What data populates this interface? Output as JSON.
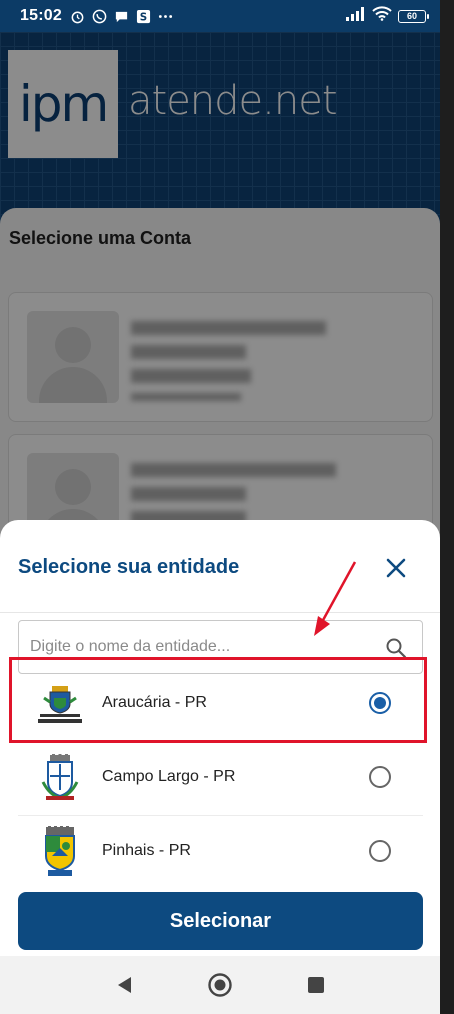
{
  "status_bar": {
    "time": "15:02",
    "battery": "60"
  },
  "brand": {
    "logo_text": "ipm",
    "product_text": "atende.net"
  },
  "page": {
    "title": "Selecione uma Conta"
  },
  "sheet": {
    "title": "Selecione sua entidade",
    "search_placeholder": "Digite o nome da entidade...",
    "entities": [
      {
        "name": "Araucária - PR",
        "selected": true
      },
      {
        "name": "Campo Largo - PR",
        "selected": false
      },
      {
        "name": "Pinhais - PR",
        "selected": false
      }
    ],
    "select_button": "Selecionar"
  },
  "colors": {
    "primary": "#0d4a80",
    "accent": "#1a5fa7",
    "highlight": "#e0142a"
  },
  "icons": [
    "alarm-icon",
    "whatsapp-icon",
    "chat-icon",
    "s-app-icon",
    "more-icon",
    "signal-icon",
    "wifi-icon",
    "battery-icon",
    "close-icon",
    "search-icon",
    "back-icon",
    "home-icon",
    "recents-icon"
  ]
}
